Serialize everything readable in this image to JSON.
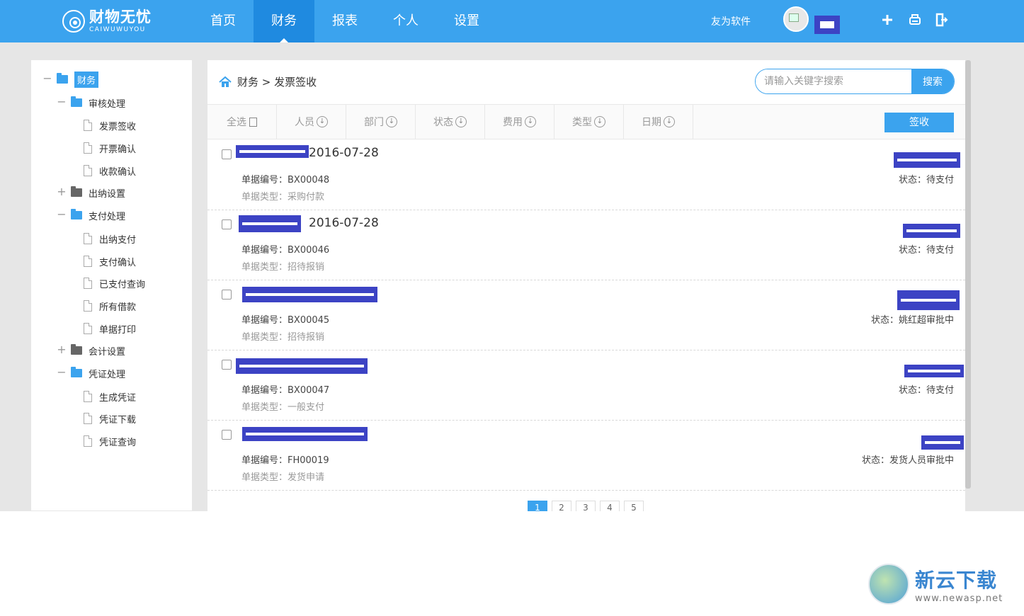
{
  "brand": {
    "name_cn": "财物无忧",
    "name_en": "CAIWUWUYOU"
  },
  "nav": [
    {
      "label": "首页",
      "active": false
    },
    {
      "label": "财务",
      "active": true
    },
    {
      "label": "报表",
      "active": false
    },
    {
      "label": "个人",
      "active": false
    },
    {
      "label": "设置",
      "active": false
    }
  ],
  "header": {
    "company_link": "友为软件",
    "user_name": ""
  },
  "icons": {
    "add": "plus-icon",
    "print": "printer-icon",
    "logout": "logout-icon",
    "home": "home-icon"
  },
  "tree": [
    {
      "label": "财务",
      "kind": "folder-open",
      "toggle": "−",
      "active": true
    },
    {
      "label": "审核处理",
      "kind": "folder-open",
      "toggle": "−"
    },
    {
      "label": "发票签收",
      "kind": "file"
    },
    {
      "label": "开票确认",
      "kind": "file"
    },
    {
      "label": "收款确认",
      "kind": "file"
    },
    {
      "label": "出纳设置",
      "kind": "folder-closed",
      "toggle": "+"
    },
    {
      "label": "支付处理",
      "kind": "folder-open",
      "toggle": "−"
    },
    {
      "label": "出纳支付",
      "kind": "file"
    },
    {
      "label": "支付确认",
      "kind": "file"
    },
    {
      "label": "已支付查询",
      "kind": "file"
    },
    {
      "label": "所有借款",
      "kind": "file"
    },
    {
      "label": "单据打印",
      "kind": "file"
    },
    {
      "label": "会计设置",
      "kind": "folder-closed",
      "toggle": "+"
    },
    {
      "label": "凭证处理",
      "kind": "folder-open",
      "toggle": "−"
    },
    {
      "label": "生成凭证",
      "kind": "file"
    },
    {
      "label": "凭证下载",
      "kind": "file"
    },
    {
      "label": "凭证查询",
      "kind": "file"
    }
  ],
  "breadcrumb": "财务 > 发票签收",
  "search": {
    "placeholder": "请输入关键字搜索",
    "button": "搜索"
  },
  "filters": {
    "select_all": "全选",
    "person": "人员",
    "dept": "部门",
    "status": "状态",
    "cost": "费用",
    "type": "类型",
    "date": "日期"
  },
  "sign_button": "签收",
  "records": [
    {
      "date": "2016-07-28",
      "id_label": "单据编号：",
      "id": "BX00048",
      "type_label": "单据类型：",
      "type": "采购付款",
      "status_label": "状态：",
      "status": "待支付"
    },
    {
      "date": "2016-07-28",
      "id_label": "单据编号：",
      "id": "BX00046",
      "type_label": "单据类型：",
      "type": "招待报销",
      "status_label": "状态：",
      "status": "待支付"
    },
    {
      "date": "",
      "id_label": "单据编号：",
      "id": "BX00045",
      "type_label": "单据类型：",
      "type": "招待报销",
      "status_label": "状态：",
      "status": "姚红超审批中"
    },
    {
      "date": "",
      "id_label": "单据编号：",
      "id": "BX00047",
      "type_label": "单据类型：",
      "type": "一般支付",
      "status_label": "状态：",
      "status": "待支付"
    },
    {
      "date": "",
      "id_label": "单据编号：",
      "id": "FH00019",
      "type_label": "单据类型：",
      "type": "发货申请",
      "status_label": "状态：",
      "status": "发货人员审批中"
    }
  ],
  "pager": [
    "1",
    "2",
    "3",
    "4",
    "5"
  ],
  "watermark": {
    "cn": "新云下载",
    "url": "www.newasp.net"
  },
  "colors": {
    "primary": "#3ba3ee",
    "primary_dark": "#1f8ae0",
    "redaction": "#3c43c4"
  }
}
